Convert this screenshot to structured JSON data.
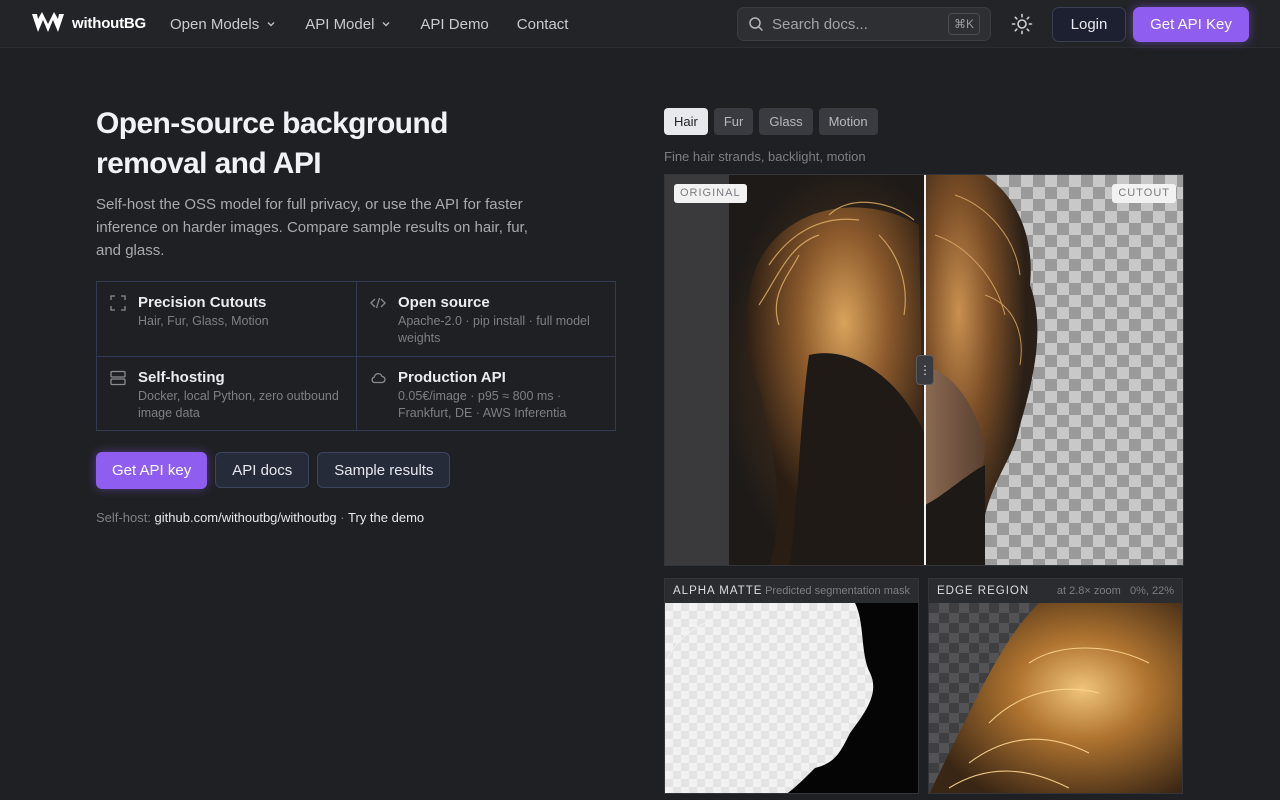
{
  "nav": {
    "brand": "withoutBG",
    "links": [
      "Open Models",
      "API Model",
      "API Demo",
      "Contact"
    ],
    "search_placeholder": "Search docs...",
    "search_shortcut": "⌘K",
    "login": "Login",
    "get_api_key": "Get API Key"
  },
  "hero": {
    "title": "Open-source background removal and API",
    "subtitle": "Self-host the OSS model for full privacy, or use the API for faster inference on harder images. Compare sample results on hair, fur, and glass."
  },
  "features": [
    {
      "title": "Precision Cutouts",
      "desc": "Hair, Fur, Glass, Motion",
      "icon": "crop-corners-icon"
    },
    {
      "title": "Open source",
      "desc": "Apache-2.0 · pip install · full model weights",
      "icon": "code-icon"
    },
    {
      "title": "Self-hosting",
      "desc": "Docker, local Python, zero outbound image data",
      "icon": "server-icon"
    },
    {
      "title": "Production API",
      "desc": "0.05€/image · p95 ≈ 800 ms · Frankfurt, DE · AWS Inferentia",
      "icon": "cloud-icon"
    }
  ],
  "cta": {
    "primary": "Get API key",
    "docs": "API docs",
    "samples": "Sample results"
  },
  "selfhost": {
    "prefix": "Self-host:",
    "repo": "github.com/withoutbg/withoutbg",
    "sep": "·",
    "demo": "Try the demo"
  },
  "demo": {
    "tabs": [
      "Hair",
      "Fur",
      "Glass",
      "Motion"
    ],
    "active_tab": "Hair",
    "caption": "Fine hair strands, backlight, motion",
    "original_label": "ORIGINAL",
    "cutout_label": "CUTOUT",
    "handle_glyph": "⋮",
    "alpha_title": "ALPHA MATTE",
    "alpha_note": "Predicted segmentation mask",
    "edge_title": "EDGE REGION",
    "edge_zoom": "at 2.8× zoom",
    "edge_note": "0%, 22%"
  },
  "colors": {
    "accent": "#8f5ef0",
    "background": "#1f2023",
    "nav": "#232428"
  }
}
